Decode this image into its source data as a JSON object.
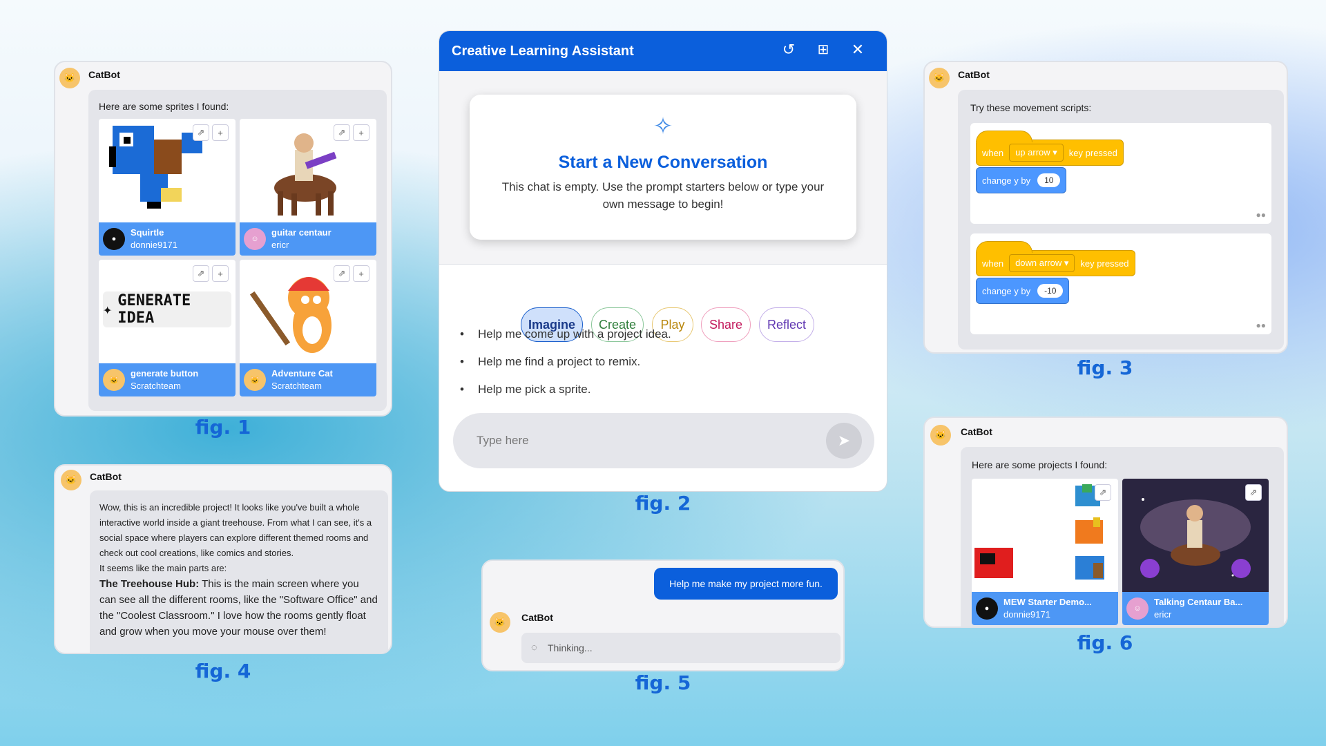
{
  "figures": [
    "fig. 1",
    "fig. 2",
    "fig. 3",
    "fig. 4",
    "fig. 5",
    "fig. 6"
  ],
  "bot_name": "CatBot",
  "fig1": {
    "intro": "Here are some sprites I found:",
    "cards": [
      {
        "title": "Squirtle",
        "user": "donnie9171"
      },
      {
        "title": "guitar centaur",
        "user": "ericr"
      },
      {
        "title": "generate button",
        "user": "Scratchteam",
        "image_text": "GENERATE IDEA"
      },
      {
        "title": "Adventure Cat",
        "user": "Scratchteam"
      }
    ]
  },
  "fig2": {
    "title": "Creative Learning Assistant",
    "card_title": "Start a New Conversation",
    "card_text_1": "This chat is empty. Use the prompt starters below or type your",
    "card_text_2": "own message to begin!",
    "chips": [
      {
        "label": "Imagine",
        "color": "#1a3a8a"
      },
      {
        "label": "Create",
        "color": "#2e7d3a"
      },
      {
        "label": "Play",
        "color": "#b8860b"
      },
      {
        "label": "Share",
        "color": "#c2185b"
      },
      {
        "label": "Reflect",
        "color": "#5e35b1"
      }
    ],
    "prompts": [
      "Help me come up with a project idea.",
      "Help me find a project to remix.",
      "Help me pick a sprite."
    ],
    "input_placeholder": "Type here"
  },
  "fig3": {
    "intro": "Try these movement scripts:",
    "scripts": [
      {
        "when": "when",
        "key": "up arrow",
        "pressed": "key pressed",
        "action": "change y by",
        "value": "10"
      },
      {
        "when": "when",
        "key": "down arrow",
        "pressed": "key pressed",
        "action": "change y by",
        "value": "-10"
      }
    ]
  },
  "fig4": {
    "p1": "Wow, this is an incredible project! It looks like you've built a whole interactive world inside a giant treehouse. From what I can see, it's a social space where players can explore different themed rooms and check out cool creations, like comics and stories.",
    "p2": "It seems like the main parts are:",
    "bold": "The Treehouse Hub:",
    "p3": "This is the main screen where you can see all the different rooms, like the \"Software Office\" and the \"Coolest Classroom.\" I love how the rooms gently float and grow when you move your mouse over them!"
  },
  "fig5": {
    "user_message": "Help me make my project more fun.",
    "thinking": "Thinking..."
  },
  "fig6": {
    "intro": "Here are some projects I found:",
    "cards": [
      {
        "title": "MEW Starter Demo...",
        "user": "donnie9171"
      },
      {
        "title": "Talking Centaur Ba...",
        "user": "ericr"
      }
    ]
  },
  "colors": {
    "accent": "#0b5fdc",
    "card_blue": "#4d97f5",
    "label_blue": "#1566d6"
  }
}
